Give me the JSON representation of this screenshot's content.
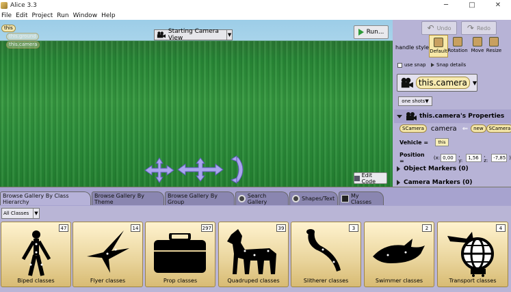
{
  "window": {
    "title": "Alice  3.3",
    "controls": {
      "minimize": "─",
      "maximize": "□",
      "close": "✕"
    }
  },
  "menu": [
    "File",
    "Edit",
    "Project",
    "Run",
    "Window",
    "Help"
  ],
  "scene": {
    "tags": {
      "this": "this",
      "ground": "this.ground",
      "camera": "this.camera"
    },
    "camera_view": "Starting Camera View",
    "run_label": "Run...",
    "edit_code_label": "Edit Code"
  },
  "right_panel": {
    "undo": "Undo",
    "redo": "Redo",
    "handle_style_label": "handle style:",
    "handle_styles": [
      "Default",
      "Rotation",
      "Move",
      "Resize"
    ],
    "use_snap": "use snap",
    "snap_details": "Snap details",
    "selected_object": "this.camera",
    "one_shots": "one shots",
    "properties_title": "this.camera's Properties",
    "type_pill": "SCamera",
    "object_name": "camera",
    "new_pill": "new",
    "new_type_pill": "SCamera",
    "vehicle_label": "Vehicle =",
    "vehicle_value": "this",
    "position_label": "Position =",
    "position_open": "(x:",
    "x": "0,00",
    "y_label": ", y:",
    "y": "1,56",
    "z_label": ", z:",
    "z": "-7,85",
    "position_close": ")",
    "object_markers": "Object Markers (0)",
    "camera_markers": "Camera Markers (0)"
  },
  "tabs": [
    "Browse Gallery By Class Hierarchy",
    "Browse Gallery By Theme",
    "Browse Gallery By Group",
    "Search Gallery",
    "Shapes/Text",
    "My Classes"
  ],
  "gallery_filter": "All Classes",
  "gallery": [
    {
      "label": "Biped classes",
      "count": "47"
    },
    {
      "label": "Flyer classes",
      "count": "14"
    },
    {
      "label": "Prop classes",
      "count": "297"
    },
    {
      "label": "Quadruped classes",
      "count": "39"
    },
    {
      "label": "Slitherer classes",
      "count": "3"
    },
    {
      "label": "Swimmer classes",
      "count": "2"
    },
    {
      "label": "Transport classes",
      "count": "4"
    }
  ]
}
